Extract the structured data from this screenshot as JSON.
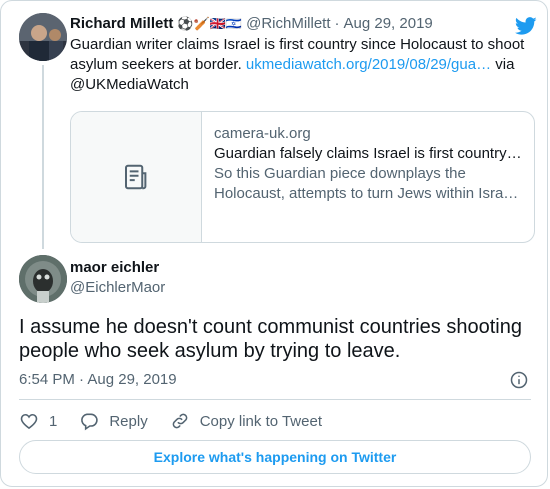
{
  "parent_tweet": {
    "author_name": "Richard Millett",
    "emojis": "⚽🏏🇬🇧🇮🇱",
    "handle": "@RichMillett",
    "separator": "·",
    "date": "Aug 29, 2019",
    "text_before_link": "Guardian writer claims Israel is first country since Holocaust to shoot asylum seekers at border. ",
    "link_text": "ukmediawatch.org/2019/08/29/gua…",
    "text_after_link": " via @UKMediaWatch",
    "link_card": {
      "domain": "camera-uk.org",
      "title": "Guardian falsely claims Israel is first country…",
      "description": "So this Guardian piece downplays the Holocaust, attempts to turn Jews within Isra…",
      "thumb_icon": "article-icon"
    }
  },
  "main_tweet": {
    "author_name": "maor eichler",
    "handle": "@EichlerMaor",
    "text": "I assume he doesn't count communist countries shooting people who seek asylum by trying to leave.",
    "timestamp": "6:54 PM · Aug 29, 2019",
    "likes_count": "1",
    "reply_label": "Reply",
    "copy_link_label": "Copy link to Tweet"
  },
  "explore_button_label": "Explore what's happening on Twitter",
  "colors": {
    "accent": "#1d9bf0",
    "text": "#0f1419",
    "secondary": "#536471",
    "border": "#cfd9de"
  }
}
